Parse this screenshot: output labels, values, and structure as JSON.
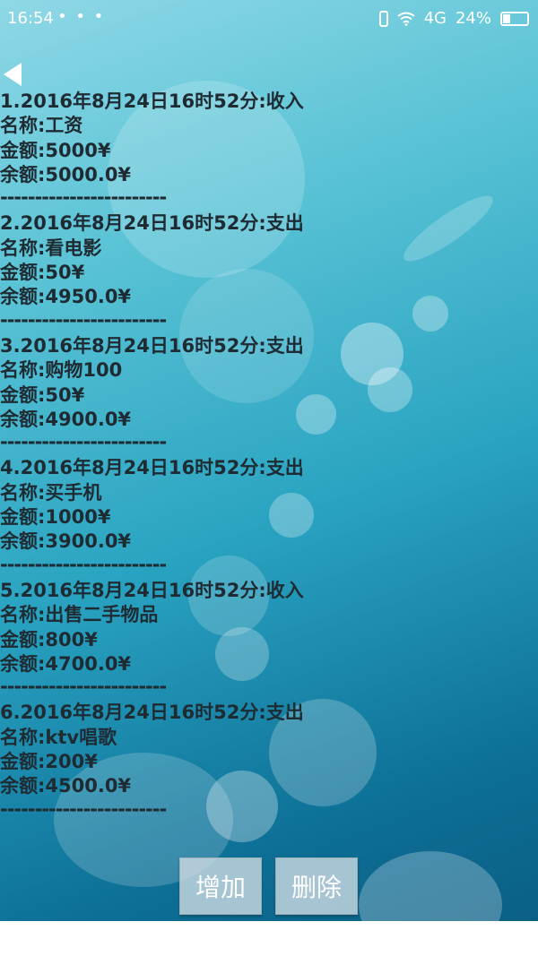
{
  "status_bar": {
    "time": "16:54",
    "notification_dots": "• • •",
    "network": "4G",
    "battery_text": "24%"
  },
  "records": [
    {
      "header": "1.2016年8月24日16时52分:收入",
      "name": "名称:工资",
      "amount": "金额:5000¥",
      "balance": "余额:5000.0¥",
      "divider": "------------------------"
    },
    {
      "header": "2.2016年8月24日16时52分:支出",
      "name": "名称:看电影",
      "amount": "金额:50¥",
      "balance": "余额:4950.0¥",
      "divider": "------------------------"
    },
    {
      "header": "3.2016年8月24日16时52分:支出",
      "name": "名称:购物100",
      "amount": "金额:50¥",
      "balance": "余额:4900.0¥",
      "divider": "------------------------"
    },
    {
      "header": "4.2016年8月24日16时52分:支出",
      "name": "名称:买手机",
      "amount": "金额:1000¥",
      "balance": "余额:3900.0¥",
      "divider": "------------------------"
    },
    {
      "header": "5.2016年8月24日16时52分:收入",
      "name": "名称:出售二手物品",
      "amount": "金额:800¥",
      "balance": "余额:4700.0¥",
      "divider": "------------------------"
    },
    {
      "header": "6.2016年8月24日16时52分:支出",
      "name": "名称:ktv唱歌",
      "amount": "金额:200¥",
      "balance": "余额:4500.0¥",
      "divider": "------------------------"
    }
  ],
  "buttons": {
    "add_label": "增加",
    "delete_label": "删除"
  },
  "icons": {
    "back": "back-arrow-icon",
    "vibrate": "vibrate-icon",
    "wifi": "wifi-icon",
    "battery": "battery-icon"
  }
}
